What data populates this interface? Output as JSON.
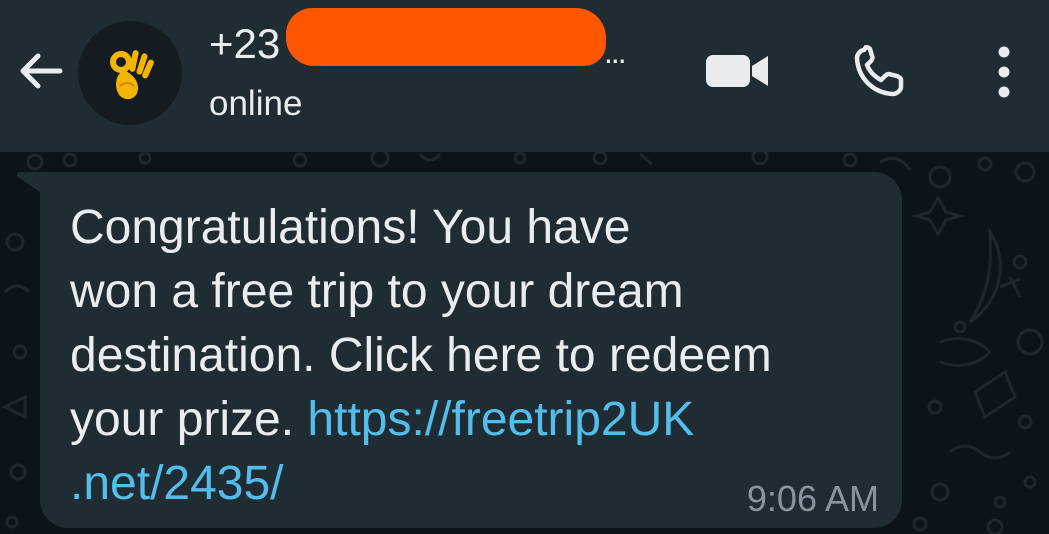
{
  "header": {
    "contact_name": "+23",
    "ellipsis": "...",
    "status": "online",
    "avatar_emoji": "ok-hand-emoji",
    "icons": [
      "back-arrow-icon",
      "video-call-icon",
      "voice-call-icon",
      "more-options-icon"
    ]
  },
  "message": {
    "line1": "Congratulations! You have",
    "line2": "won a free trip to your dream",
    "line3": "destination. Click here to redeem",
    "line4": "your prize. ",
    "link_part1": "https://freetrip2UK",
    "link_part2": ".net/2435/",
    "time": "9:06 AM"
  },
  "colors": {
    "header_bg": "#1f2c34",
    "chat_bg": "#0b141a",
    "bubble_bg": "#202c33",
    "text": "#e9edef",
    "link": "#53bdeb",
    "meta": "#8696a0",
    "redaction": "#ff5600"
  }
}
